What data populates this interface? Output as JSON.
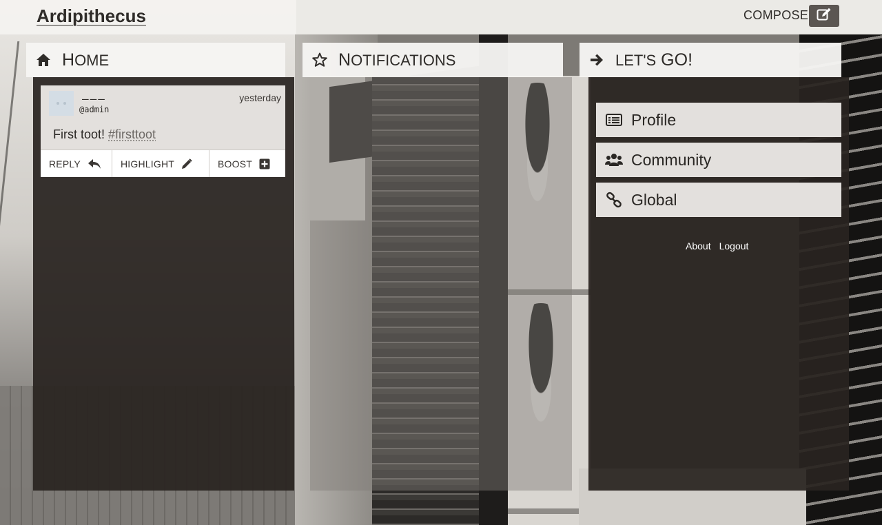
{
  "app": {
    "brand": "Ardipithecus"
  },
  "topbar": {
    "compose_label": "COMPOSE",
    "compose_icon": "edit-icon"
  },
  "columns": {
    "home": {
      "title_cap": "H",
      "title_rest": "OME",
      "icon": "home-icon"
    },
    "notifications": {
      "title_cap": "N",
      "title_rest": "OTIFICATIONS",
      "icon": "star-icon"
    },
    "go": {
      "title_lower": "LET'S",
      "title_cap": " GO!",
      "icon": "arrow-right-icon"
    }
  },
  "toot": {
    "display_name": "———",
    "handle": "@admin",
    "time": "yesterday",
    "text": "First toot! ",
    "hashtag": "#firsttoot",
    "actions": {
      "reply": "REPLY",
      "highlight": "HIGHLIGHT",
      "boost": "BOOST"
    }
  },
  "menu": {
    "profile": "Profile",
    "community": "Community",
    "global": "Global"
  },
  "footer": {
    "about": "About",
    "logout": "Logout"
  },
  "colors": {
    "panel_dark": "#292420",
    "header_bg": "#f6f5f3",
    "menu_bg": "#e3e0dd",
    "compose_btn": "#5b5652"
  }
}
